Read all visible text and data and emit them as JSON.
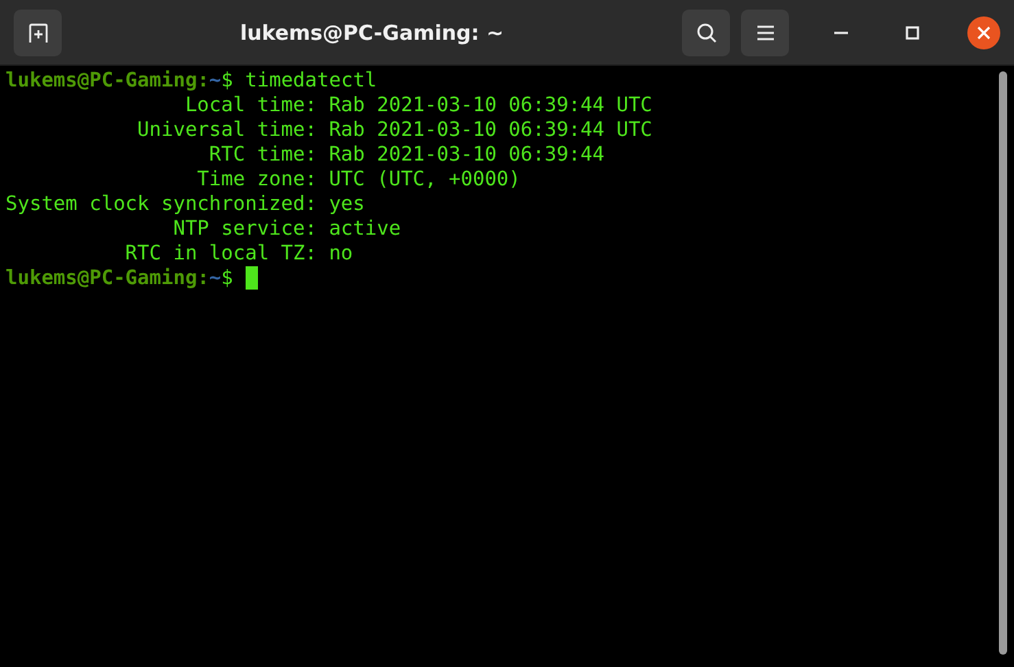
{
  "window": {
    "title": "lukems@PC-Gaming: ~"
  },
  "terminal": {
    "lines": [
      {
        "kind": "prompt",
        "user_host": "lukems@PC-Gaming",
        "separator": ":",
        "path": "~",
        "symbol": "$",
        "command": "timedatectl",
        "cursor": false
      },
      {
        "kind": "output",
        "text": "               Local time: Rab 2021-03-10 06:39:44 UTC"
      },
      {
        "kind": "output",
        "text": "           Universal time: Rab 2021-03-10 06:39:44 UTC"
      },
      {
        "kind": "output",
        "text": "                 RTC time: Rab 2021-03-10 06:39:44"
      },
      {
        "kind": "output",
        "text": "                Time zone: UTC (UTC, +0000)"
      },
      {
        "kind": "output",
        "text": "System clock synchronized: yes"
      },
      {
        "kind": "output",
        "text": "              NTP service: active"
      },
      {
        "kind": "output",
        "text": "          RTC in local TZ: no"
      },
      {
        "kind": "prompt",
        "user_host": "lukems@PC-Gaming",
        "separator": ":",
        "path": "~",
        "symbol": "$",
        "cursor": true
      }
    ]
  }
}
